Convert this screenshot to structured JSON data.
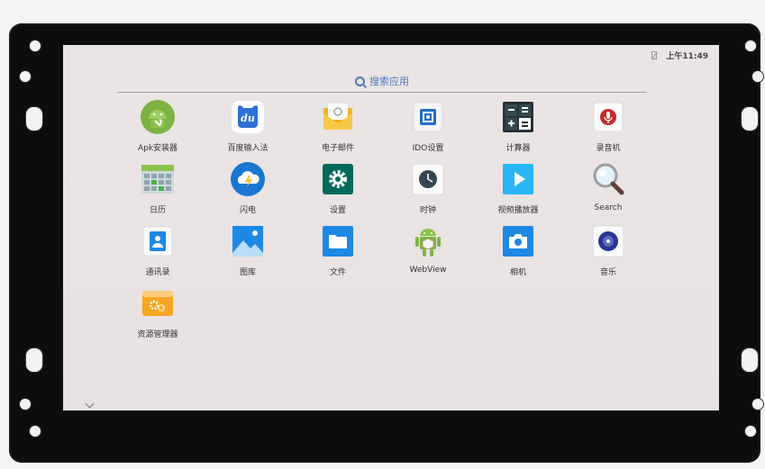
{
  "status_bar": {
    "time": "上午11:49",
    "icons": [
      "no-sim-icon"
    ]
  },
  "search": {
    "label": "搜索应用",
    "icon": "search-icon"
  },
  "apps": [
    {
      "label": "Apk安装器",
      "icon": "android-wrench-icon",
      "color": "#7cb342"
    },
    {
      "label": "百度输入法",
      "icon": "baidu-du-icon",
      "color": "#2f6fd8"
    },
    {
      "label": "电子邮件",
      "icon": "email-envelope-icon",
      "color": "#f0b31e"
    },
    {
      "label": "IDO设置",
      "icon": "ido-settings-icon",
      "color": "#1f6fc7"
    },
    {
      "label": "计算器",
      "icon": "calculator-icon",
      "color": "#263238"
    },
    {
      "label": "录音机",
      "icon": "microphone-icon",
      "color": "#c62828"
    },
    {
      "label": "日历",
      "icon": "calendar-grid-icon",
      "color": "#8bc34a"
    },
    {
      "label": "闪电",
      "icon": "lightning-cloud-icon",
      "color": "#1976d2"
    },
    {
      "label": "设置",
      "icon": "gear-icon",
      "color": "#00695c"
    },
    {
      "label": "时钟",
      "icon": "clock-icon",
      "color": "#37474f"
    },
    {
      "label": "视频播放器",
      "icon": "play-icon",
      "color": "#29b6f6"
    },
    {
      "label": "Search",
      "icon": "magnifier-icon",
      "color": "#5c6bc0"
    },
    {
      "label": "通讯录",
      "icon": "contacts-icon",
      "color": "#1e88e5"
    },
    {
      "label": "图库",
      "icon": "gallery-icon",
      "color": "#1e88e5"
    },
    {
      "label": "文件",
      "icon": "folder-icon",
      "color": "#1e88e5"
    },
    {
      "label": "WebView",
      "icon": "android-cube-icon",
      "color": "#7cb342"
    },
    {
      "label": "相机",
      "icon": "camera-icon",
      "color": "#1e88e5"
    },
    {
      "label": "音乐",
      "icon": "music-disc-icon",
      "color": "#283593"
    },
    {
      "label": "资源管理器",
      "icon": "file-manager-icon",
      "color": "#f5a623"
    }
  ]
}
